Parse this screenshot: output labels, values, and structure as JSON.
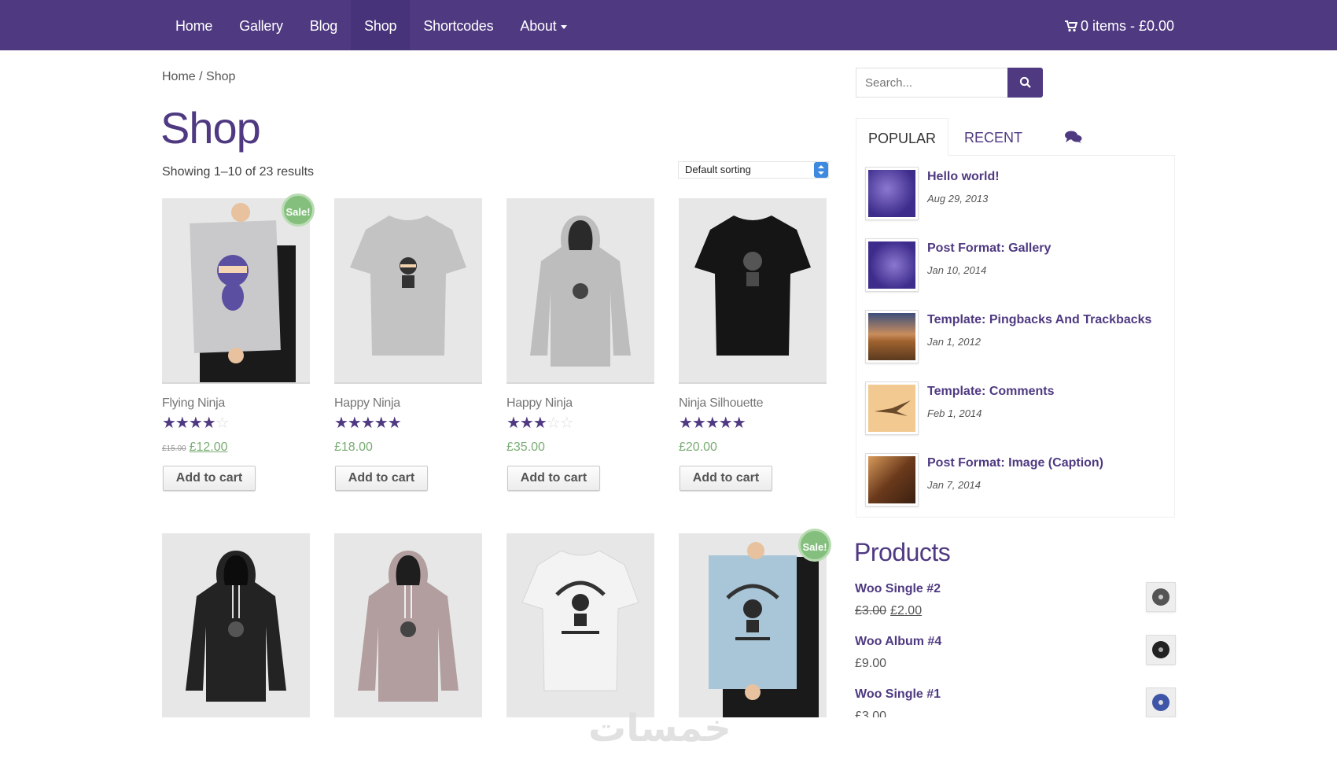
{
  "nav": {
    "items": [
      {
        "label": "Home"
      },
      {
        "label": "Gallery"
      },
      {
        "label": "Blog"
      },
      {
        "label": "Shop"
      },
      {
        "label": "Shortcodes"
      },
      {
        "label": "About"
      }
    ],
    "cart_label": "0 items - £0.00",
    "accent_color": "#4f3a82"
  },
  "breadcrumb": "Home / Shop",
  "page_title": "Shop",
  "result_count": "Showing 1–10 of 23 results",
  "sorting": {
    "selected": "Default sorting"
  },
  "products": [
    {
      "name": "Flying Ninja",
      "rating": 4,
      "price_old": "£15.00",
      "price": "£12.00",
      "on_sale": true,
      "sale_badge": "Sale!",
      "button": "Add to cart",
      "image": "poster-ninja"
    },
    {
      "name": "Happy Ninja",
      "rating": 5,
      "price": "£18.00",
      "on_sale": false,
      "button": "Add to cart",
      "image": "grey-tshirt"
    },
    {
      "name": "Happy Ninja",
      "rating": 3,
      "price": "£35.00",
      "on_sale": false,
      "button": "Add to cart",
      "image": "grey-hoodie"
    },
    {
      "name": "Ninja Silhouette",
      "rating": 5,
      "price": "£20.00",
      "on_sale": false,
      "button": "Add to cart",
      "image": "black-tshirt"
    },
    {
      "image": "black-hoodie",
      "on_sale": false
    },
    {
      "image": "pink-hoodie",
      "on_sale": false
    },
    {
      "image": "white-tshirt",
      "on_sale": false
    },
    {
      "image": "blue-poster",
      "on_sale": true,
      "sale_badge": "Sale!"
    }
  ],
  "sidebar": {
    "search_placeholder": "Search...",
    "tabs": {
      "popular": "POPULAR",
      "recent": "RECENT"
    },
    "posts": [
      {
        "title": "Hello world!",
        "date": "Aug 29, 2013",
        "thumb": "purple-texture"
      },
      {
        "title": "Post Format: Gallery",
        "date": "Jan 10, 2014",
        "thumb": "purple-texture"
      },
      {
        "title": "Template: Pingbacks And Trackbacks",
        "date": "Jan 1, 2012",
        "thumb": "landscape"
      },
      {
        "title": "Template: Comments",
        "date": "Feb 1, 2014",
        "thumb": "bird"
      },
      {
        "title": "Post Format: Image (Caption)",
        "date": "Jan 7, 2014",
        "thumb": "food"
      }
    ],
    "products_title": "Products",
    "widget_products": [
      {
        "name": "Woo Single #2",
        "price_old": "£3.00",
        "price": "£2.00"
      },
      {
        "name": "Woo Album #4",
        "price": "£9.00"
      },
      {
        "name": "Woo Single #1",
        "price": "£3.00"
      }
    ]
  },
  "watermark": "خمسات"
}
